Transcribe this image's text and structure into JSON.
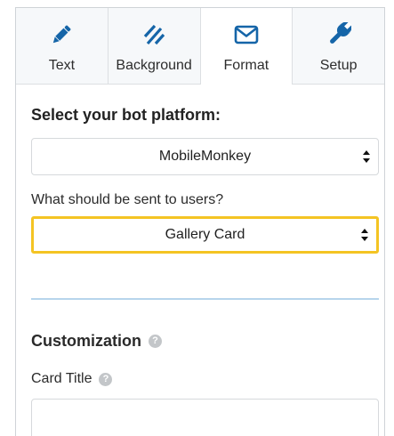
{
  "tabs": [
    {
      "label": "Text",
      "icon": "pencil-icon",
      "active": false
    },
    {
      "label": "Background",
      "icon": "diagonal-stripes-icon",
      "active": false
    },
    {
      "label": "Format",
      "icon": "envelope-icon",
      "active": true
    },
    {
      "label": "Setup",
      "icon": "wrench-icon",
      "active": false
    }
  ],
  "platform": {
    "title": "Select your bot platform:",
    "selected": "MobileMonkey"
  },
  "send": {
    "question": "What should be sent to users?",
    "selected": "Gallery Card"
  },
  "customization": {
    "title": "Customization",
    "card_title_label": "Card Title",
    "card_title_value": ""
  },
  "colors": {
    "icon": "#1565a8",
    "highlight": "#f4c423",
    "divider": "#b7d5ec"
  }
}
